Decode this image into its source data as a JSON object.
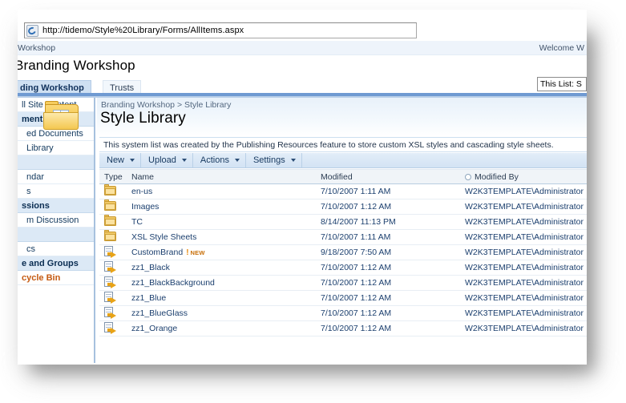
{
  "browser": {
    "url": "http://tidemo/Style%20Library/Forms/AllItems.aspx",
    "addr_icon": "ie-favicon-icon"
  },
  "globalnav": {
    "left_text": "Workshop",
    "welcome": "Welcome W"
  },
  "site": {
    "title": "Branding Workshop"
  },
  "tabs": [
    {
      "label": "ding Workshop",
      "active": true
    },
    {
      "label": "Trusts",
      "active": false
    }
  ],
  "search": {
    "scope_value": "This List: S"
  },
  "sidebar": {
    "items": [
      {
        "label": "ll Site Content",
        "type": "link"
      },
      {
        "label": "ments",
        "type": "header"
      },
      {
        "label": "ed Documents",
        "type": "link"
      },
      {
        "label": " Library",
        "type": "link"
      },
      {
        "label": "",
        "type": "spacer"
      },
      {
        "label": "ndar",
        "type": "link"
      },
      {
        "label": "s",
        "type": "link"
      },
      {
        "label": "ssions",
        "type": "header"
      },
      {
        "label": "m Discussion",
        "type": "link"
      },
      {
        "label": "",
        "type": "spacer"
      },
      {
        "label": "cs",
        "type": "link"
      },
      {
        "label": "e and Groups",
        "type": "header"
      },
      {
        "label": "cycle Bin",
        "type": "recycle"
      }
    ]
  },
  "page": {
    "library_icon": "document-library-folder-icon",
    "breadcrumb": "Branding Workshop > Style Library",
    "title": "Style Library",
    "description": "This system list was created by the Publishing Resources feature to store custom XSL styles and cascading style sheets."
  },
  "toolbar": {
    "buttons": [
      {
        "label": "New",
        "has_caret": true
      },
      {
        "label": "Upload",
        "has_caret": true
      },
      {
        "label": "Actions",
        "has_caret": true
      },
      {
        "label": "Settings",
        "has_caret": true
      }
    ]
  },
  "list": {
    "columns": [
      {
        "label": "Type",
        "key": "type"
      },
      {
        "label": "Name",
        "key": "name"
      },
      {
        "label": "Modified",
        "key": "modified"
      },
      {
        "label": "Modified By",
        "key": "modified_by",
        "filter_icon": "filter-circle-icon"
      }
    ],
    "rows": [
      {
        "icon": "folder-icon",
        "name": "en-us",
        "modified": "7/10/2007 1:11 AM",
        "modified_by": "W2K3TEMPLATE\\Administrator",
        "is_new": false
      },
      {
        "icon": "folder-icon",
        "name": "Images",
        "modified": "7/10/2007 1:12 AM",
        "modified_by": "W2K3TEMPLATE\\Administrator",
        "is_new": false
      },
      {
        "icon": "folder-icon",
        "name": "TC",
        "modified": "8/14/2007 11:13 PM",
        "modified_by": "W2K3TEMPLATE\\Administrator",
        "is_new": false
      },
      {
        "icon": "folder-icon",
        "name": "XSL Style Sheets",
        "modified": "7/10/2007 1:11 AM",
        "modified_by": "W2K3TEMPLATE\\Administrator",
        "is_new": false
      },
      {
        "icon": "file-icon",
        "name": "CustomBrand",
        "modified": "9/18/2007 7:50 AM",
        "modified_by": "W2K3TEMPLATE\\Administrator",
        "is_new": true,
        "new_label": "NEW"
      },
      {
        "icon": "file-icon",
        "name": "zz1_Black",
        "modified": "7/10/2007 1:12 AM",
        "modified_by": "W2K3TEMPLATE\\Administrator",
        "is_new": false
      },
      {
        "icon": "file-icon",
        "name": "zz1_BlackBackground",
        "modified": "7/10/2007 1:12 AM",
        "modified_by": "W2K3TEMPLATE\\Administrator",
        "is_new": false
      },
      {
        "icon": "file-icon",
        "name": "zz1_Blue",
        "modified": "7/10/2007 1:12 AM",
        "modified_by": "W2K3TEMPLATE\\Administrator",
        "is_new": false
      },
      {
        "icon": "file-icon",
        "name": "zz1_BlueGlass",
        "modified": "7/10/2007 1:12 AM",
        "modified_by": "W2K3TEMPLATE\\Administrator",
        "is_new": false
      },
      {
        "icon": "file-icon",
        "name": "zz1_Orange",
        "modified": "7/10/2007 1:12 AM",
        "modified_by": "W2K3TEMPLATE\\Administrator",
        "is_new": false
      }
    ]
  },
  "colors": {
    "accent_blue": "#6f9ad2",
    "link_blue": "#1b3f6e",
    "header_band": "#dce9f6",
    "toolbar": "#d3e3f4",
    "recycle_orange": "#c55a11",
    "new_orange": "#e8890c",
    "folder_yellow": "#f0c866"
  }
}
